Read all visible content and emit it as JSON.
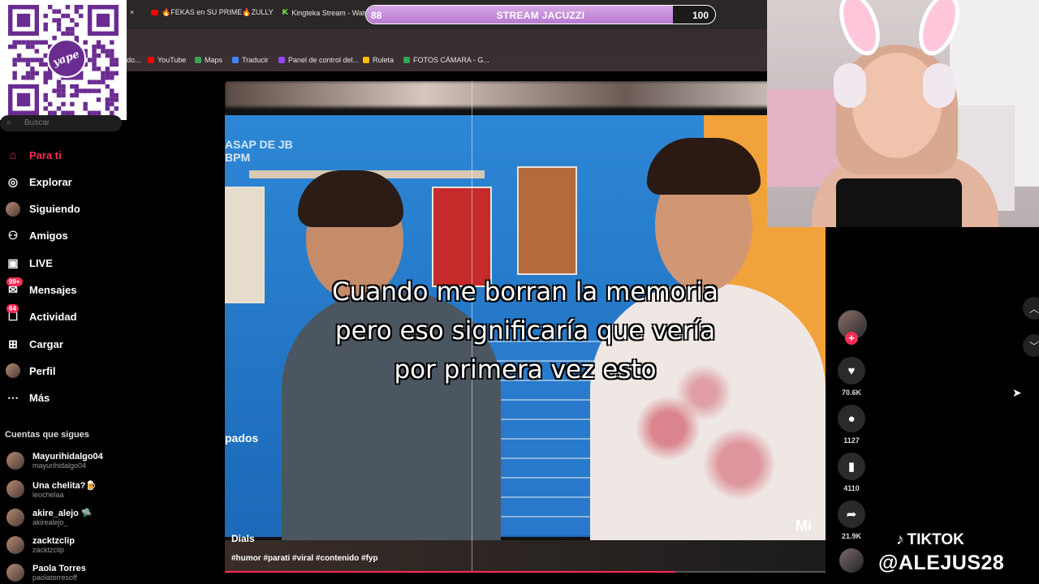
{
  "qr": {
    "badge_text": "yape"
  },
  "browser": {
    "tabs": [
      {
        "label": "×",
        "icon_color": "#e8e6e3"
      },
      {
        "label": "🔥FEKAS en SU PRIME🔥ZULLY",
        "icon_color": "#ff0000",
        "close": "×"
      },
      {
        "label": "Kingteka Stream - Watc",
        "icon_color": "#53fc18"
      }
    ],
    "bookmarks": [
      {
        "label": "do...",
        "color": "#888888"
      },
      {
        "label": "YouTube",
        "color": "#ff0000"
      },
      {
        "label": "Maps",
        "color": "#34a853"
      },
      {
        "label": "Traducir",
        "color": "#4285f4"
      },
      {
        "label": "Panel de control del...",
        "color": "#9146ff"
      },
      {
        "label": "Ruleta",
        "color": "#fbbc05"
      },
      {
        "label": "FOTOS CÁMARA - G...",
        "color": "#34a853"
      }
    ]
  },
  "stream_goal": {
    "label": "STREAM JACUZZI",
    "current": "88",
    "max": "100",
    "fraction": 0.88
  },
  "sidebar": {
    "search_placeholder": "Buscar",
    "nav": [
      {
        "label": "Para ti",
        "icon": "home-icon",
        "active": true
      },
      {
        "label": "Explorar",
        "icon": "compass-icon"
      },
      {
        "label": "Siguiendo",
        "icon": "following-avatar"
      },
      {
        "label": "Amigos",
        "icon": "friends-icon"
      },
      {
        "label": "LIVE",
        "icon": "live-icon"
      },
      {
        "label": "Mensajes",
        "icon": "messages-icon",
        "badge": "99+"
      },
      {
        "label": "Actividad",
        "icon": "activity-icon",
        "badge": "64"
      },
      {
        "label": "Cargar",
        "icon": "upload-icon"
      },
      {
        "label": "Perfil",
        "icon": "profile-avatar"
      },
      {
        "label": "Más",
        "icon": "more-icon"
      }
    ],
    "following_title": "Cuentas que sigues",
    "accounts": [
      {
        "name": "Mayurihidalgo04",
        "handle": "mayurihidalgo04"
      },
      {
        "name": "Una chelita?🍺",
        "handle": "leochelaa"
      },
      {
        "name": "akire_alejo 🛸",
        "handle": "akirealejo_"
      },
      {
        "name": "zacktzclip",
        "handle": "zacktzclip"
      },
      {
        "name": "Paola Torres",
        "handle": "paolatorresoff"
      }
    ]
  },
  "video": {
    "caption_lines": [
      "Cuando me borran la memoria",
      "pero eso significaría que vería",
      "por primera vez esto"
    ],
    "overlay_top_left": "ASAP DE JB\nBPM",
    "overlay_left": "pados",
    "overlay_right": "Mi",
    "author": "Dials",
    "hashtags": "#humor #parati #viral #contenido #fyp",
    "progress": 0.75
  },
  "actions": {
    "likes": "70.6K",
    "comments": "1127",
    "saves": "4110",
    "shares": "21.9K"
  },
  "tiktok_overlay": {
    "brand": "TIKTOK",
    "handle": "@ALEJUS28"
  },
  "colors": {
    "accent": "#fe2c55",
    "goal_fill": "#c48ad9"
  }
}
